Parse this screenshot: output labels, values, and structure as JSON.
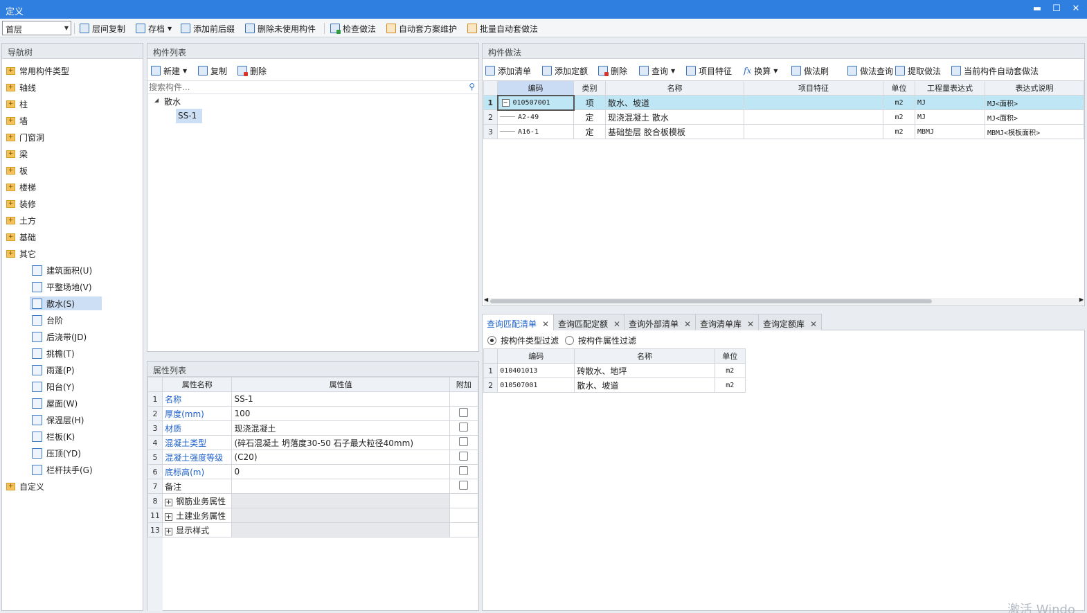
{
  "window": {
    "title": "定义",
    "min": "▬",
    "max": "☐",
    "close": "✕"
  },
  "toolbar": {
    "floor": "首层",
    "buttons": [
      "层间复制",
      "存档",
      "添加前后缀",
      "删除未使用构件",
      "检查做法",
      "自动套方案维护",
      "批量自动套做法"
    ]
  },
  "nav": {
    "title": "导航树",
    "categories": [
      "常用构件类型",
      "轴线",
      "柱",
      "墙",
      "门窗洞",
      "梁",
      "板",
      "楼梯",
      "装修",
      "土方",
      "基础",
      "其它"
    ],
    "subitems": [
      "建筑面积(U)",
      "平整场地(V)",
      "散水(S)",
      "台阶",
      "后浇带(JD)",
      "挑檐(T)",
      "雨蓬(P)",
      "阳台(Y)",
      "屋面(W)",
      "保温层(H)",
      "栏板(K)",
      "压顶(YD)",
      "栏杆扶手(G)"
    ],
    "last": "自定义"
  },
  "component_list": {
    "title": "构件列表",
    "buttons": [
      "新建",
      "复制",
      "删除"
    ],
    "search_placeholder": "搜索构件...",
    "group": "散水",
    "item": "SS-1"
  },
  "properties": {
    "title": "属性列表",
    "headers": [
      "属性名称",
      "属性值",
      "附加"
    ],
    "rows": [
      {
        "num": "1",
        "name": "名称",
        "value": "SS-1",
        "checkbox": false
      },
      {
        "num": "2",
        "name": "厚度(mm)",
        "value": "100",
        "checkbox": true
      },
      {
        "num": "3",
        "name": "材质",
        "value": "现浇混凝土",
        "checkbox": true
      },
      {
        "num": "4",
        "name": "混凝土类型",
        "value": "(碎石混凝土 坍落度30-50 石子最大粒径40mm)",
        "checkbox": true
      },
      {
        "num": "5",
        "name": "混凝土强度等级",
        "value": "(C20)",
        "checkbox": true
      },
      {
        "num": "6",
        "name": "底标高(m)",
        "value": "0",
        "checkbox": true
      },
      {
        "num": "7",
        "name": "备注",
        "value": "",
        "checkbox": true
      }
    ],
    "groups": [
      {
        "num": "8",
        "name": "钢筋业务属性"
      },
      {
        "num": "11",
        "name": "土建业务属性"
      },
      {
        "num": "13",
        "name": "显示样式"
      }
    ]
  },
  "method": {
    "title": "构件做法",
    "buttons": [
      "添加清单",
      "添加定额",
      "删除",
      "查询",
      "项目特征",
      "换算",
      "做法刷",
      "做法查询",
      "提取做法",
      "当前构件自动套做法"
    ],
    "fx": "fx",
    "headers": [
      "编码",
      "类别",
      "名称",
      "项目特征",
      "单位",
      "工程量表达式",
      "表达式说明"
    ],
    "rows": [
      {
        "num": "1",
        "code": "010507001",
        "type": "项",
        "name": "散水、坡道",
        "feature": "",
        "unit": "m2",
        "expr": "MJ",
        "desc": "MJ<面积>"
      },
      {
        "num": "2",
        "code": "A2-49",
        "type": "定",
        "name": "现浇混凝土 散水",
        "feature": "",
        "unit": "m2",
        "expr": "MJ",
        "desc": "MJ<面积>"
      },
      {
        "num": "3",
        "code": "A16-1",
        "type": "定",
        "name": "基础垫层 胶合板模板",
        "feature": "",
        "unit": "m2",
        "expr": "MBMJ",
        "desc": "MBMJ<模板面积>"
      }
    ]
  },
  "query": {
    "tabs": [
      "查询匹配清单",
      "查询匹配定额",
      "查询外部清单",
      "查询清单库",
      "查询定额库"
    ],
    "filters": [
      "按构件类型过滤",
      "按构件属性过滤"
    ],
    "headers": [
      "编码",
      "名称",
      "单位"
    ],
    "rows": [
      {
        "num": "1",
        "code": "010401013",
        "name": "砖散水、地坪",
        "unit": "m2"
      },
      {
        "num": "2",
        "code": "010507001",
        "name": "散水、坡道",
        "unit": "m2"
      }
    ]
  },
  "watermark": "激活 Windo"
}
